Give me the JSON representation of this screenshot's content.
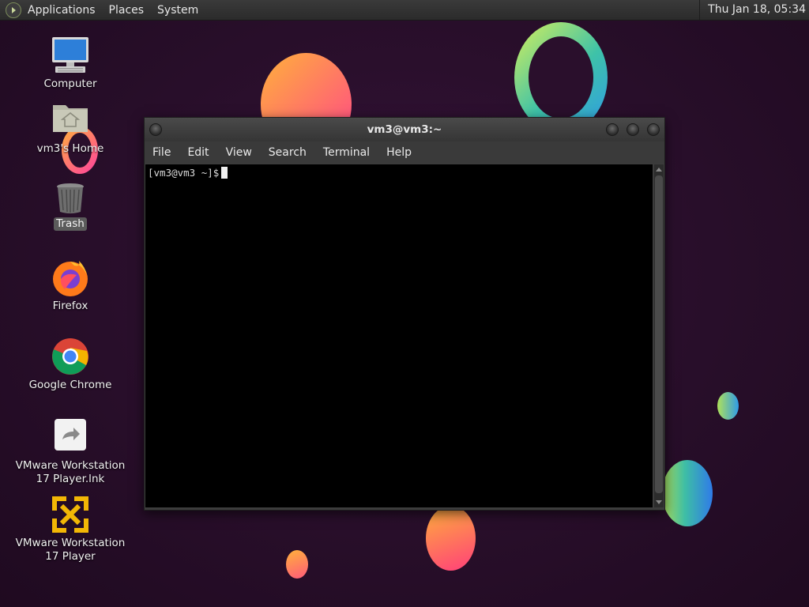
{
  "panel": {
    "menus": [
      "Applications",
      "Places",
      "System"
    ],
    "clock": "Thu Jan 18, 05:34"
  },
  "desktop_icons": [
    {
      "label": "Computer",
      "icon": "computer-icon"
    },
    {
      "label": "vm3's Home",
      "icon": "home-folder-icon"
    },
    {
      "label": "Trash",
      "icon": "trash-icon",
      "selected": true
    },
    {
      "label": "Firefox",
      "icon": "firefox-icon"
    },
    {
      "label": "Google Chrome",
      "icon": "chrome-icon"
    },
    {
      "label": "VMware Workstation 17 Player.lnk",
      "line1": "VMware Workstation",
      "line2": "17 Player.lnk",
      "icon": "shortcut-icon"
    },
    {
      "label": "VMware Workstation 17 Player",
      "line1": "VMware Workstation",
      "line2": "17 Player",
      "icon": "vmware-icon"
    }
  ],
  "terminal": {
    "title": "vm3@vm3:~",
    "menu": [
      "File",
      "Edit",
      "View",
      "Search",
      "Terminal",
      "Help"
    ],
    "prompt": "[vm3@vm3 ~]$"
  },
  "colors": {
    "desktop_bg": "#2a0f2c",
    "panel_bg": "#2f2f2f",
    "terminal_bg": "#000000"
  }
}
